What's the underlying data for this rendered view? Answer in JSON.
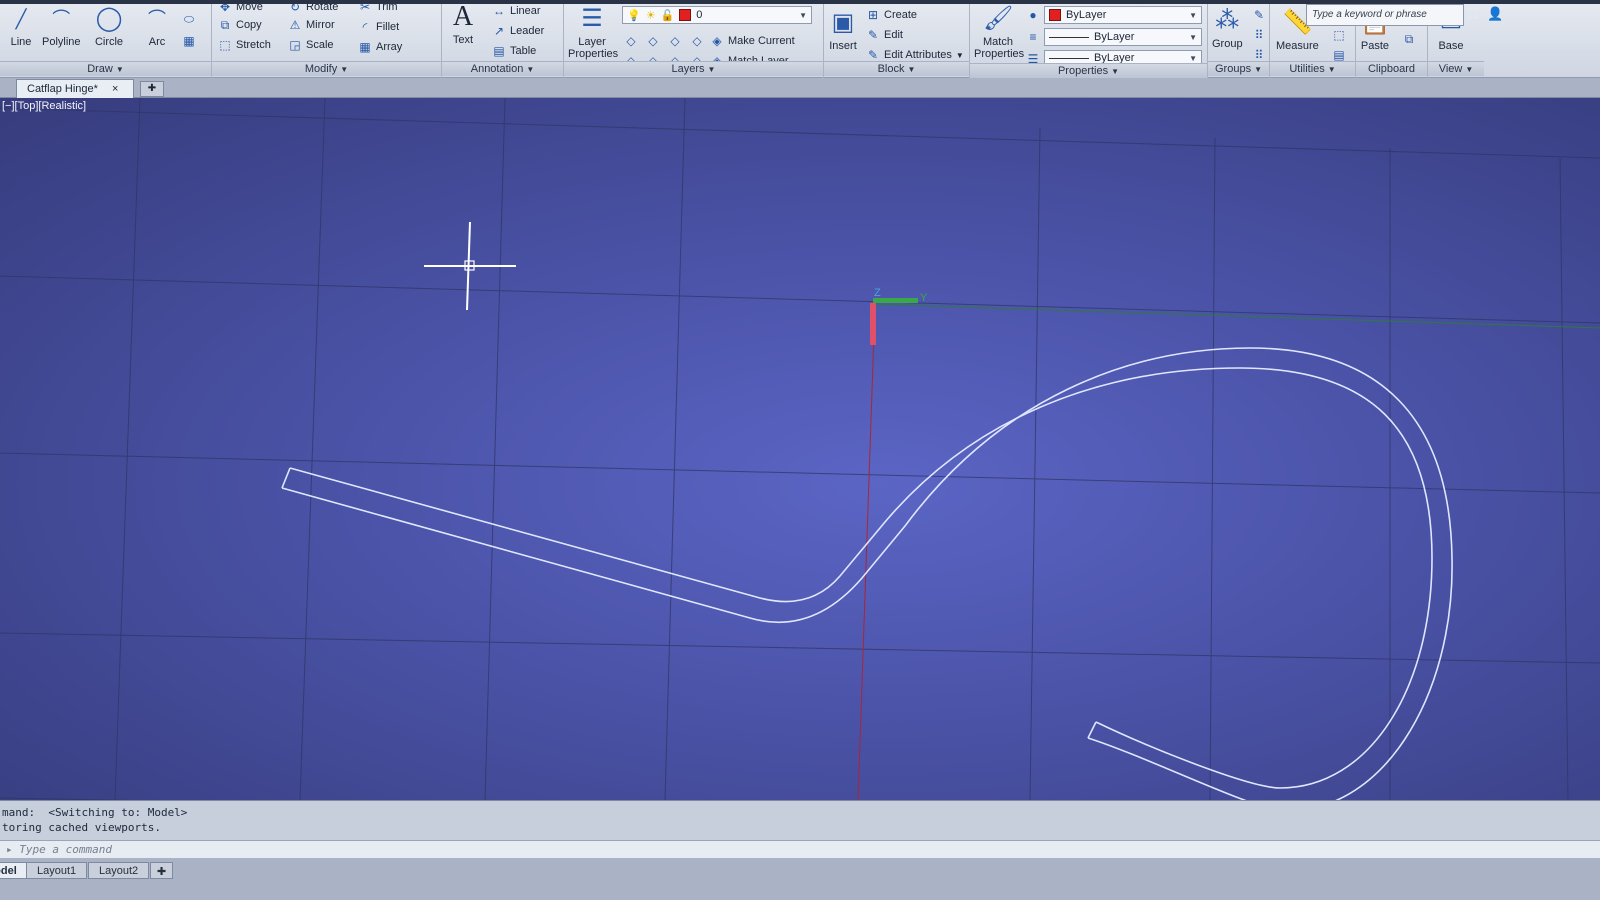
{
  "search": {
    "placeholder": "Type a keyword or phrase"
  },
  "ribbon": {
    "draw": {
      "title": "Draw",
      "tools": [
        "Line",
        "Polyline",
        "Circle",
        "Arc"
      ]
    },
    "modify": {
      "title": "Modify",
      "tools": [
        "Move",
        "Rotate",
        "Trim",
        "Copy",
        "Mirror",
        "Fillet",
        "Stretch",
        "Scale",
        "Array"
      ]
    },
    "annotation": {
      "title": "Annotation",
      "text_label": "Text",
      "tools": [
        "Linear",
        "Leader",
        "Table"
      ]
    },
    "layers": {
      "title": "Layers",
      "properties_label": "Layer Properties",
      "current_layer": "0",
      "tools": [
        "Make Current",
        "Match Layer"
      ]
    },
    "block": {
      "title": "Block",
      "insert_label": "Insert",
      "tools": [
        "Create",
        "Edit",
        "Edit Attributes"
      ]
    },
    "properties": {
      "title": "Properties",
      "match_label": "Match Properties",
      "color": "ByLayer",
      "linetype": "ByLayer",
      "lineweight": "ByLayer",
      "color_hex": "#e32020"
    },
    "groups": {
      "title": "Groups",
      "group_label": "Group"
    },
    "utilities": {
      "title": "Utilities",
      "measure_label": "Measure"
    },
    "clipboard": {
      "title": "Clipboard",
      "paste_label": "Paste"
    },
    "view": {
      "title": "View",
      "base_label": "Base"
    }
  },
  "file_tabs": {
    "active": "Catflap Hinge*"
  },
  "viewport": {
    "label": "[−][Top][Realistic]",
    "ucs_y_label": "Y",
    "ucs_z_label": "Z",
    "background_hex": "#4a52a6",
    "geometry_hex": "#dfe6ff"
  },
  "command_line": {
    "history": [
      "mand:  <Switching to: Model>",
      "toring cached viewports."
    ],
    "input_placeholder": "Type a command"
  },
  "layout_tabs": [
    "Model",
    "Layout1",
    "Layout2"
  ]
}
